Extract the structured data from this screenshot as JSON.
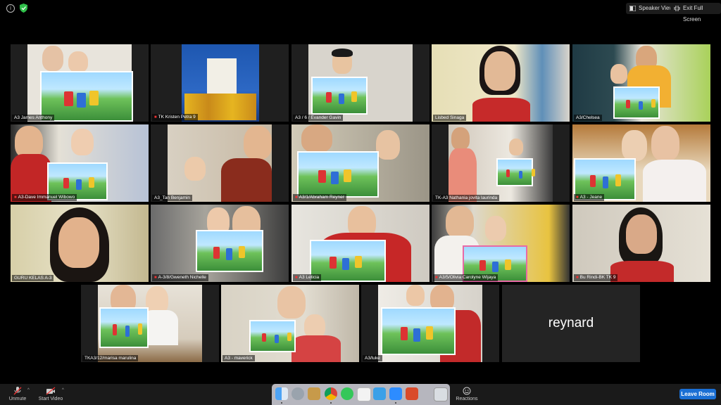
{
  "top_bar": {
    "speaker_view": "Speaker View",
    "exit_full_screen": "Exit Full Screen"
  },
  "participants": [
    {
      "name": "A3 James Anthony",
      "muted": false,
      "icon": "video-tile"
    },
    {
      "name": "TK Kristen Petra 9",
      "muted": true,
      "icon": "video-tile"
    },
    {
      "name": "A3 / 6 / Evander Gavin",
      "muted": false,
      "icon": "video-tile"
    },
    {
      "name": "Lisbed Sinaga",
      "muted": false,
      "icon": "video-tile"
    },
    {
      "name": "A3/Chelsea",
      "muted": false,
      "icon": "video-tile"
    },
    {
      "name": "A3-Dave Immanuel Wibowo",
      "muted": true,
      "icon": "video-tile"
    },
    {
      "name": "A3_Tan Benjamin",
      "muted": false,
      "icon": "video-tile"
    },
    {
      "name": "A3/1/Abraham Reyner",
      "muted": true,
      "icon": "video-tile"
    },
    {
      "name": "TK-A3 Nathania jovita laurinda",
      "muted": false,
      "icon": "video-tile"
    },
    {
      "name": "A3 - Jeane",
      "muted": true,
      "icon": "video-tile"
    },
    {
      "name": "GURU KELAS A-3",
      "muted": false,
      "icon": "video-tile"
    },
    {
      "name": "A-3/8/Gweneth Nichelle",
      "muted": true,
      "icon": "video-tile"
    },
    {
      "name": "A3 Leticia",
      "muted": true,
      "icon": "video-tile"
    },
    {
      "name": "A3/5/Olivia Carolyne Wijaya",
      "muted": true,
      "icon": "video-tile"
    },
    {
      "name": "Bu Rindi-BK TK 9",
      "muted": true,
      "icon": "video-tile"
    },
    {
      "name": "TKA3/12/marisa marulina",
      "muted": false,
      "icon": "video-tile"
    },
    {
      "name": "A3 - maverick",
      "muted": false,
      "icon": "video-tile"
    },
    {
      "name": "A3/luke",
      "muted": false,
      "icon": "video-tile"
    },
    {
      "name": "reynard",
      "muted": false,
      "icon": "no-video"
    }
  ],
  "toolbar": {
    "unmute": "Unmute",
    "start_video": "Start Video",
    "reactions": "Reactions",
    "leave_room": "Leave Room"
  },
  "colors": {
    "active_speaker": "#cfe43a",
    "leave_button": "#1a6fd4",
    "muted_icon": "#e33333"
  }
}
